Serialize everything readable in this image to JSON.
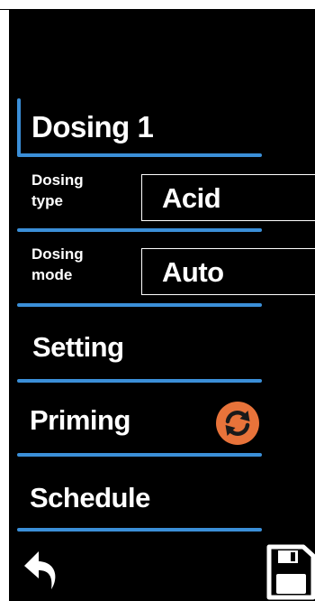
{
  "header": {
    "title": "Dosing 1"
  },
  "fields": [
    {
      "label_line1": "Dosing",
      "label_line2": "type",
      "value": "Acid"
    },
    {
      "label_line1": "Dosing",
      "label_line2": "mode",
      "value": "Auto"
    }
  ],
  "menu": {
    "setting_label": "Setting",
    "priming_label": "Priming",
    "schedule_label": "Schedule"
  },
  "icons": {
    "priming": "refresh-icon",
    "back": "back-arrow-icon",
    "save": "save-icon"
  },
  "colors": {
    "background": "#000000",
    "accent_blue": "#3b8fd8",
    "priming_orange": "#e8733a",
    "text": "#ffffff"
  }
}
